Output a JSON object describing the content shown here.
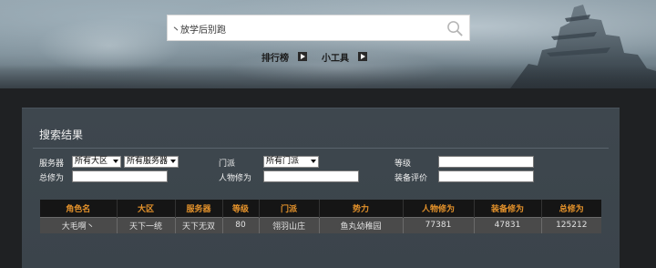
{
  "search": {
    "value": "丶放学后别跑",
    "placeholder": ""
  },
  "nav": [
    {
      "label": "排行榜",
      "icon": "play-arrow-icon"
    },
    {
      "label": "小工具",
      "icon": "play-arrow-icon"
    }
  ],
  "panel": {
    "title": "搜索结果"
  },
  "filters": {
    "server_label": "服务器",
    "region_select": "所有大区",
    "server_select": "所有服务器",
    "sect_label": "门派",
    "sect_select": "所有门派",
    "level_label": "等级",
    "level_value": "",
    "total_label": "总修为",
    "total_value": "",
    "char_label": "人物修为",
    "char_value": "",
    "equip_label": "装备评价",
    "equip_value": ""
  },
  "table": {
    "headers": [
      "角色名",
      "大区",
      "服务器",
      "等级",
      "门派",
      "势力",
      "人物修为",
      "装备修为",
      "总修为"
    ],
    "rows": [
      [
        "大毛啊丶",
        "天下一统",
        "天下无双",
        "80",
        "翎羽山庄",
        "鱼丸幼稚园",
        "77381",
        "47831",
        "125212"
      ]
    ]
  },
  "colors": {
    "header_text": "#e4922b",
    "panel_bg": "#3e474e",
    "row_bg": "#4a4a4a"
  }
}
